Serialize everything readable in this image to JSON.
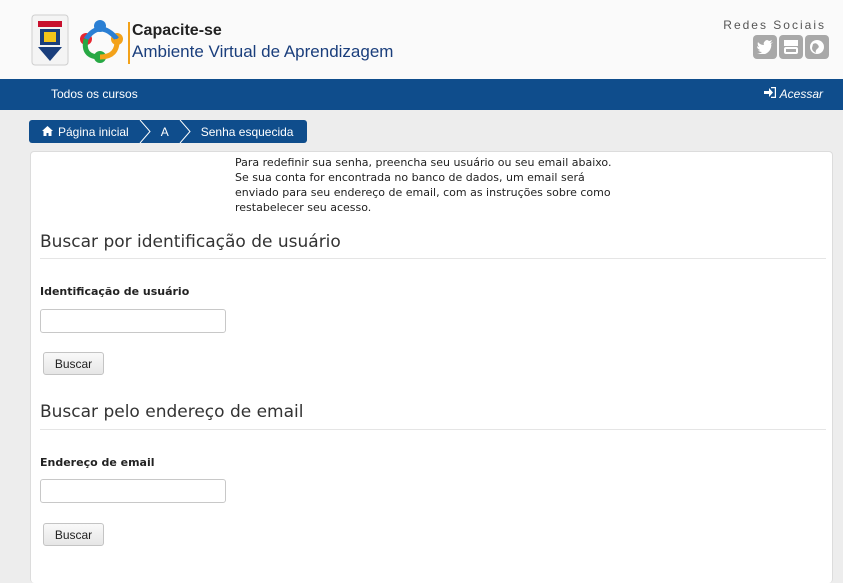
{
  "header": {
    "brand_title": "Capacite-se",
    "brand_subtitle": "Ambiente Virtual de Aprendizagem",
    "social_title": "Redes Sociais",
    "social_icons": [
      "twitter-icon",
      "youtube-icon",
      "globe-icon"
    ]
  },
  "navbar": {
    "all_courses": "Todos os cursos",
    "login": "Acessar"
  },
  "breadcrumb": {
    "home": "Página inicial",
    "item2": "A",
    "item3": "Senha esquecida"
  },
  "main": {
    "intro": "Para redefinir sua senha, preencha seu usuário ou seu email abaixo. Se sua conta for encontrada no banco de dados, um email será enviado para seu endereço de email, com as instruções sobre como restabelecer seu acesso.",
    "section_username": {
      "heading": "Buscar por identificação de usuário",
      "label": "Identificação de usuário",
      "value": "",
      "button": "Buscar"
    },
    "section_email": {
      "heading": "Buscar pelo endereço de email",
      "label": "Endereço de email",
      "value": "",
      "button": "Buscar"
    }
  },
  "colors": {
    "navbar": "#0f4d8c",
    "brand_subtitle": "#1a3e7c",
    "accent_bar": "#f3a21a"
  }
}
